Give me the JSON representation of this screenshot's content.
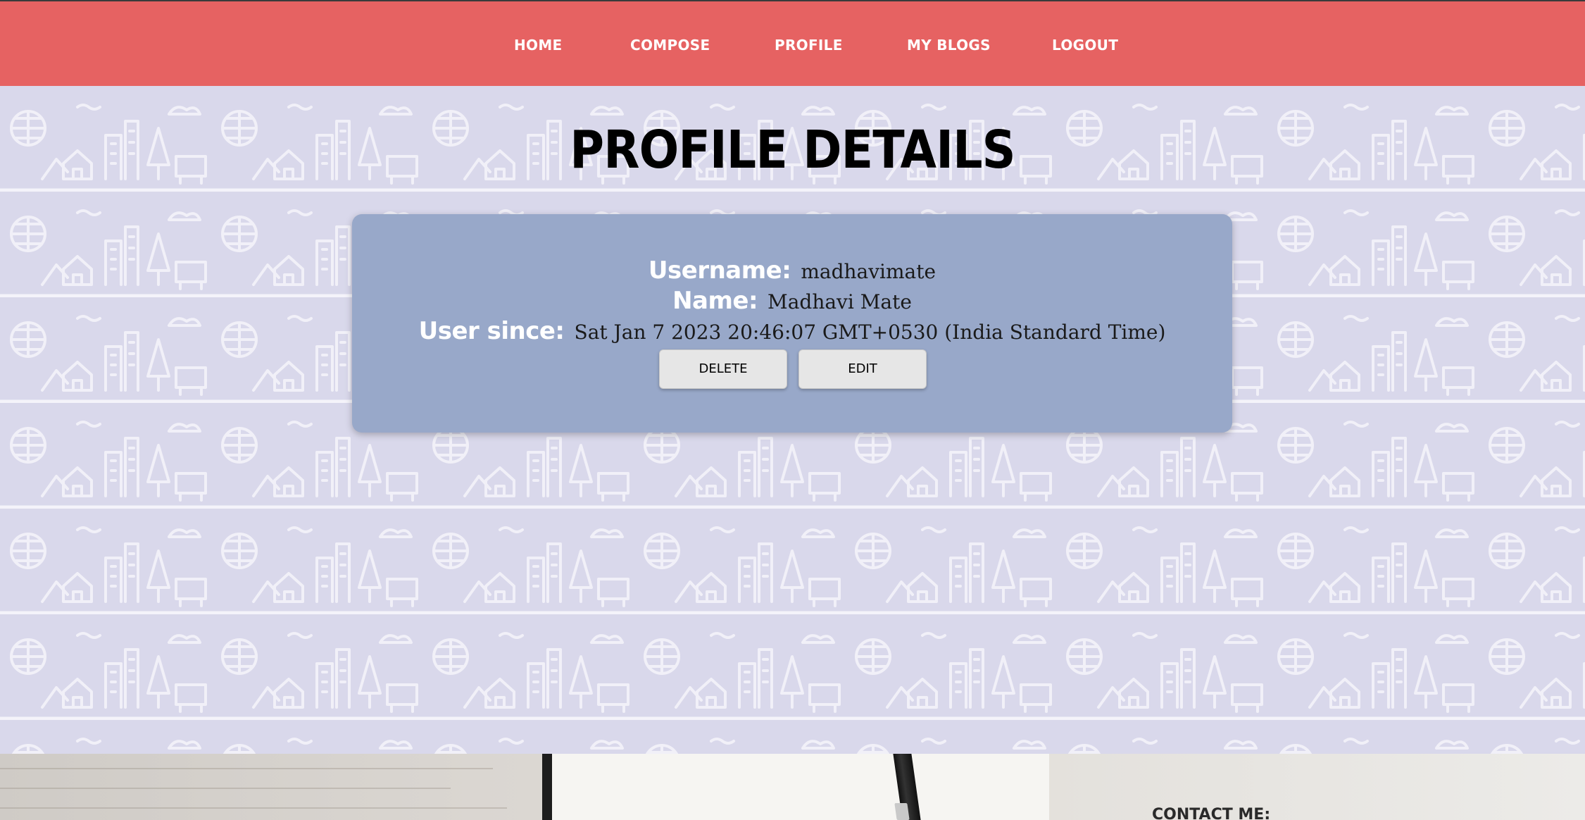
{
  "nav": {
    "items": [
      {
        "label": "HOME"
      },
      {
        "label": "COMPOSE"
      },
      {
        "label": "PROFILE"
      },
      {
        "label": "MY BLOGS"
      },
      {
        "label": "LOGOUT"
      }
    ]
  },
  "page": {
    "title": "PROFILE DETAILS"
  },
  "profile": {
    "username_label": "Username:",
    "username": "madhavimate",
    "name_label": "Name:",
    "name": "Madhavi Mate",
    "since_label": "User since:",
    "since": "Sat Jan 7 2023 20:46:07 GMT+0530 (India Standard Time)"
  },
  "actions": {
    "delete_label": "DELETE",
    "edit_label": "EDIT"
  },
  "footer": {
    "contact_heading": "CONTACT ME:"
  },
  "colors": {
    "navbar": "#e66262",
    "card": "#98a8c9",
    "pattern_bg": "#d9d8eb"
  }
}
